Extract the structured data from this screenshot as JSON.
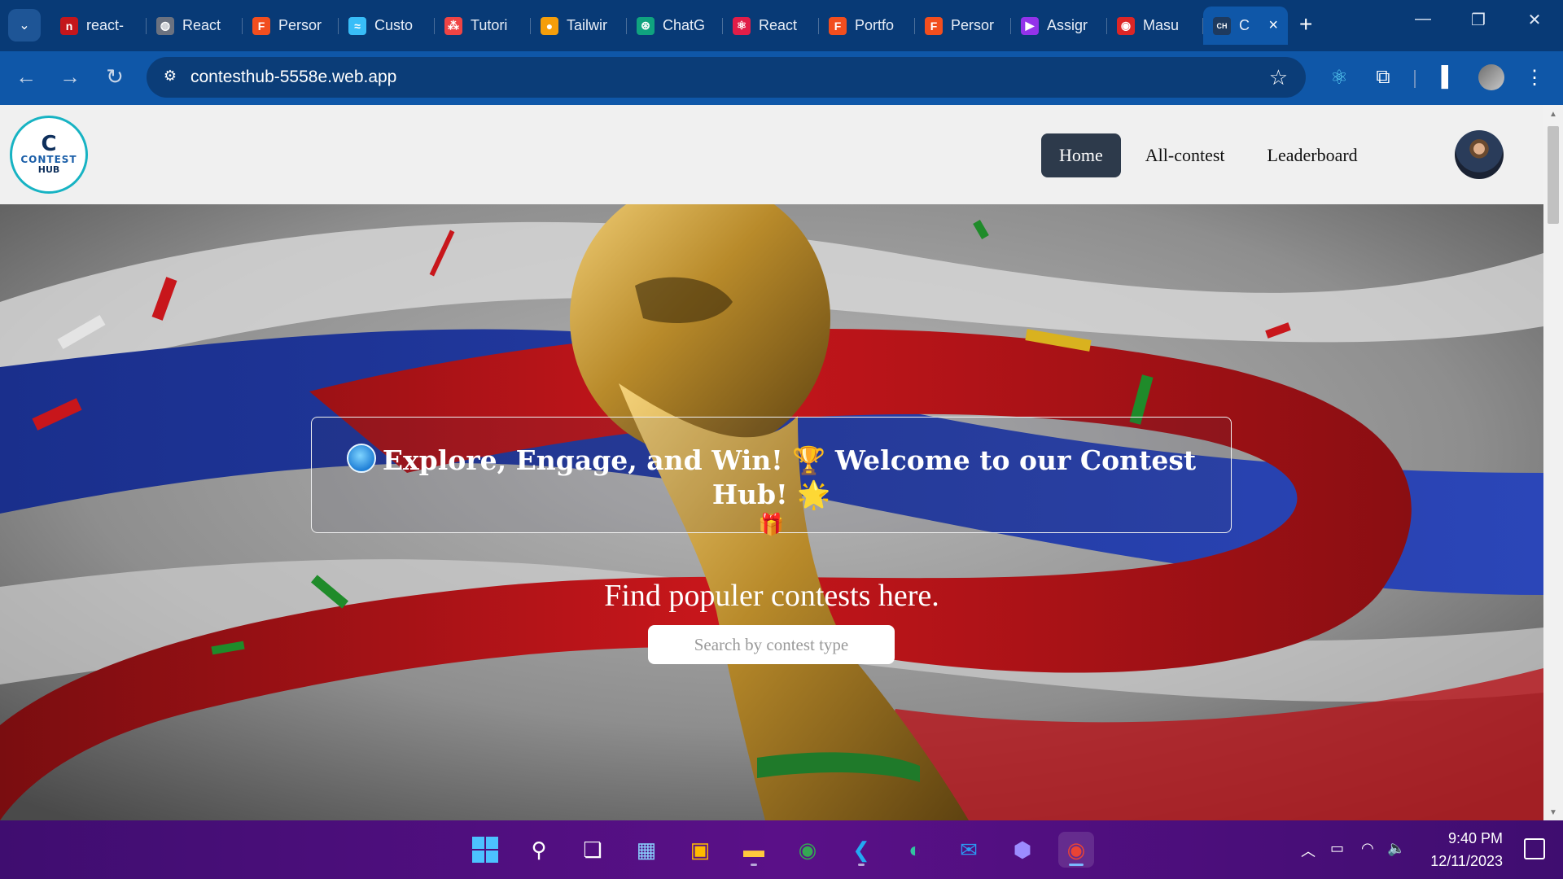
{
  "browser": {
    "tabs": [
      {
        "label": "react-",
        "color": "#c4161c",
        "glyph": "n"
      },
      {
        "label": "React",
        "color": "#6b7280",
        "glyph": "◍"
      },
      {
        "label": "Persor",
        "color": "#f24e1e",
        "glyph": "F"
      },
      {
        "label": "Custo",
        "color": "#38bdf8",
        "glyph": "≈"
      },
      {
        "label": "Tutori",
        "color": "#ef4444",
        "glyph": "⁂"
      },
      {
        "label": "Tailwir",
        "color": "#f59e0b",
        "glyph": "●"
      },
      {
        "label": "ChatG",
        "color": "#10a37f",
        "glyph": "⊛"
      },
      {
        "label": "React",
        "color": "#e11d48",
        "glyph": "⚛"
      },
      {
        "label": "Portfo",
        "color": "#f24e1e",
        "glyph": "F"
      },
      {
        "label": "Persor",
        "color": "#f24e1e",
        "glyph": "F"
      },
      {
        "label": "Assigr",
        "color": "#9333ea",
        "glyph": "▶"
      },
      {
        "label": "Masu",
        "color": "#dc2626",
        "glyph": "◉"
      },
      {
        "label": "C",
        "color": "#1e3a5f",
        "glyph": "CH",
        "active": true
      }
    ],
    "new_tab_icon": "plus-icon",
    "url": "contesthub-5558e.web.app"
  },
  "site": {
    "logo": {
      "mark": "C",
      "line1": "CONTEST",
      "line2": "HUB"
    },
    "nav": [
      {
        "label": "Home",
        "active": true
      },
      {
        "label": "All-contest",
        "active": false
      },
      {
        "label": "Leaderboard",
        "active": false
      }
    ],
    "banner": {
      "text1": "Explore, Engage, and Win!",
      "trophy": "🏆",
      "text2": "Welcome to our Contest Hub!",
      "star": "🌟",
      "gift": "🎁"
    },
    "tagline": "Find populer contests here.",
    "search_placeholder": "Search by contest type"
  },
  "taskbar": {
    "time": "9:40 PM",
    "date": "12/11/2023"
  }
}
